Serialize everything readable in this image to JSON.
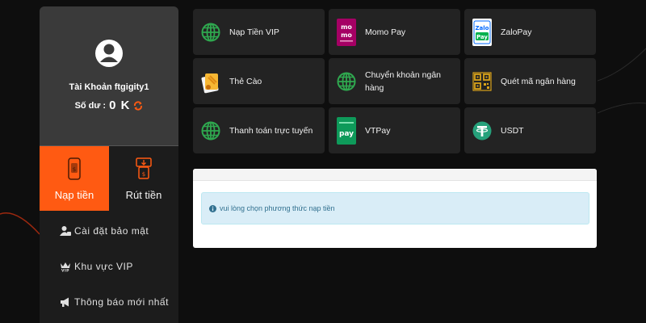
{
  "profile": {
    "account_name": "Tài Khoản ftgigity1",
    "balance_label": "Số dư :",
    "balance_value": "0 K"
  },
  "actions": [
    {
      "label": "Nạp tiền",
      "active": true
    },
    {
      "label": "Rút tiền",
      "active": false
    }
  ],
  "menu": [
    {
      "label": "Cài đặt bảo mật",
      "icon": "user-lock-icon"
    },
    {
      "label": "Khu vực VIP",
      "icon": "vip-crown-icon"
    },
    {
      "label": "Thông báo mới nhất",
      "icon": "megaphone-icon"
    }
  ],
  "payment_methods": [
    {
      "label": "Nạp Tiền VIP",
      "icon": "globe-icon"
    },
    {
      "label": "Momo Pay",
      "icon": "momo-icon",
      "icon_text": "mo mo"
    },
    {
      "label": "ZaloPay",
      "icon": "zalopay-icon",
      "icon_text": "Zalo Pay"
    },
    {
      "label": "Thẻ Cào",
      "icon": "scratch-card-icon"
    },
    {
      "label": "Chuyển khoản ngân hàng",
      "icon": "globe-icon"
    },
    {
      "label": "Quét mã ngân hàng",
      "icon": "qr-code-icon"
    },
    {
      "label": "Thanh toán trực tuyến",
      "icon": "globe-icon"
    },
    {
      "label": "VTPay",
      "icon": "vtpay-icon",
      "icon_text": "pay"
    },
    {
      "label": "USDT",
      "icon": "tether-icon"
    }
  ],
  "alert": {
    "text": "vui lòng chọn phương thức nạp tiền"
  },
  "colors": {
    "accent": "#ff5a12",
    "globe_green": "#2fa84f",
    "momo": "#a50064",
    "zalopay": "#0068ff",
    "vtpay": "#0e9a5a",
    "tether": "#26a17b",
    "alert_bg": "#d9edf7",
    "alert_text": "#31708f"
  }
}
